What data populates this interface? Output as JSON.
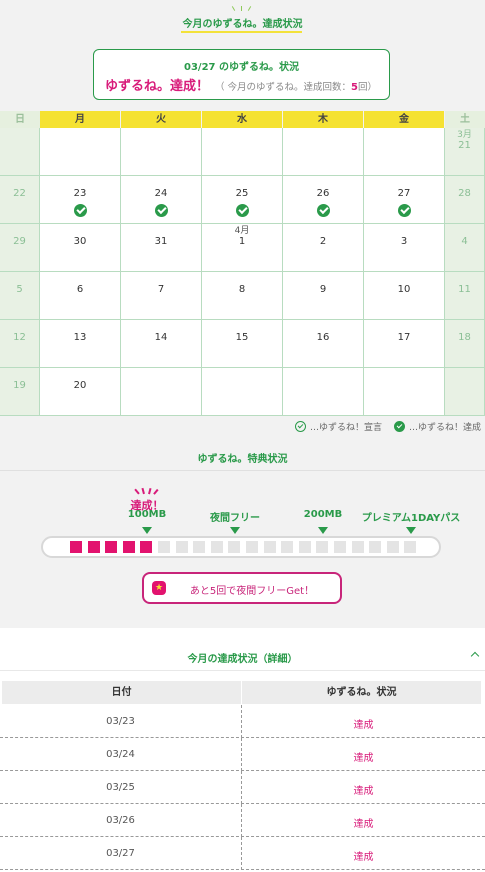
{
  "header": {
    "title": "今月のゆずるね。達成状況"
  },
  "status_box": {
    "line1": "03/27 のゆずるね。状況",
    "achieved_label": "ゆずるね。達成！",
    "count_prefix": "（ 今月のゆずるね。達成回数：",
    "count_value": "5",
    "count_suffix": "回）"
  },
  "calendar": {
    "weekdays": [
      "日",
      "月",
      "火",
      "水",
      "木",
      "金",
      "土"
    ],
    "rows": [
      [
        {
          "num": "",
          "month": ""
        },
        {
          "num": "",
          "month": ""
        },
        {
          "num": "",
          "month": ""
        },
        {
          "num": "",
          "month": ""
        },
        {
          "num": "",
          "month": ""
        },
        {
          "num": "",
          "month": ""
        },
        {
          "num": "21",
          "month": "3月"
        }
      ],
      [
        {
          "num": "22",
          "month": ""
        },
        {
          "num": "23",
          "month": "",
          "done": true
        },
        {
          "num": "24",
          "month": "",
          "done": true
        },
        {
          "num": "25",
          "month": "",
          "done": true
        },
        {
          "num": "26",
          "month": "",
          "done": true
        },
        {
          "num": "27",
          "month": "",
          "done": true
        },
        {
          "num": "28",
          "month": ""
        }
      ],
      [
        {
          "num": "29",
          "month": ""
        },
        {
          "num": "30",
          "month": ""
        },
        {
          "num": "31",
          "month": ""
        },
        {
          "num": "1",
          "month": "4月"
        },
        {
          "num": "2",
          "month": ""
        },
        {
          "num": "3",
          "month": ""
        },
        {
          "num": "4",
          "month": ""
        }
      ],
      [
        {
          "num": "5",
          "month": ""
        },
        {
          "num": "6",
          "month": ""
        },
        {
          "num": "7",
          "month": ""
        },
        {
          "num": "8",
          "month": ""
        },
        {
          "num": "9",
          "month": ""
        },
        {
          "num": "10",
          "month": ""
        },
        {
          "num": "11",
          "month": ""
        }
      ],
      [
        {
          "num": "12",
          "month": ""
        },
        {
          "num": "13",
          "month": ""
        },
        {
          "num": "14",
          "month": ""
        },
        {
          "num": "15",
          "month": ""
        },
        {
          "num": "16",
          "month": ""
        },
        {
          "num": "17",
          "month": ""
        },
        {
          "num": "18",
          "month": ""
        }
      ],
      [
        {
          "num": "19",
          "month": ""
        },
        {
          "num": "20",
          "month": ""
        },
        {
          "num": "",
          "month": ""
        },
        {
          "num": "",
          "month": ""
        },
        {
          "num": "",
          "month": ""
        },
        {
          "num": "",
          "month": ""
        },
        {
          "num": "",
          "month": ""
        }
      ]
    ]
  },
  "legend": {
    "declared": "…ゆずるね！宣言",
    "achieved": "…ゆずるね！達成"
  },
  "bonus": {
    "title": "ゆずるね。特典状況",
    "achieved_badge": "達成！",
    "milestones": [
      {
        "label": "100MB",
        "achieved": true
      },
      {
        "label": "夜間フリー",
        "achieved": false
      },
      {
        "label": "200MB",
        "achieved": false
      },
      {
        "label": "プレミアム1DAYパス",
        "achieved": false
      }
    ],
    "progress": {
      "done": 5,
      "total": 20
    },
    "next_button": {
      "icon": "star-icon",
      "label": "あと5回で夜間フリーGet！"
    }
  },
  "detail": {
    "title": "今月の達成状況（詳細）",
    "columns": [
      "日付",
      "ゆずるね。状況"
    ],
    "rows": [
      {
        "date": "03/23",
        "status": "達成"
      },
      {
        "date": "03/24",
        "status": "達成"
      },
      {
        "date": "03/25",
        "status": "達成"
      },
      {
        "date": "03/26",
        "status": "達成"
      },
      {
        "date": "03/27",
        "status": "達成"
      }
    ]
  },
  "colors": {
    "green": "#2a9a4a",
    "pink": "#d81b7a",
    "yellow": "#f5e232"
  }
}
